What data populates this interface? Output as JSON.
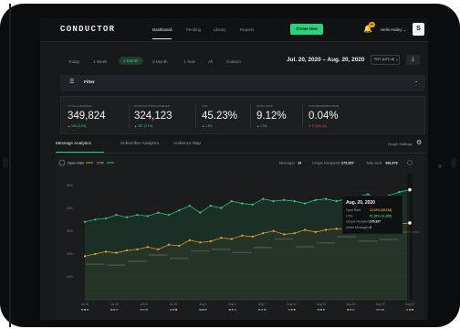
{
  "app": {
    "logo": "CONDUCTOR"
  },
  "nav": {
    "items": [
      "Dashboard",
      "Pending",
      "Library",
      "Reports"
    ],
    "create_label": "Create New",
    "notification_count": "9+",
    "user_label": "Hello Hailey",
    "avatar_letter": "S"
  },
  "date": {
    "ranges": [
      "Today",
      "1 Week",
      "1 Month",
      "3 Month",
      "1 Year",
      "All",
      "Custom"
    ],
    "selected": "1 Month",
    "display": "Jul. 20, 2020 – Aug. 20, 2020",
    "timezone": "PDT (UTC-8)"
  },
  "filter": {
    "label": "Filter"
  },
  "stats": [
    {
      "label": "TOTAL AUDIENCE",
      "value": "349,824",
      "sub": "▲ 153 (0.4%)",
      "trend": "up"
    },
    {
      "label": "NOTIFICATIONS ENABLED",
      "value": "324,123",
      "sub": "▲ 387 (0.1%)",
      "trend": "up"
    },
    {
      "label": "CTR",
      "value": "45.23%",
      "sub": "▲ 1.5%",
      "trend": "up"
    },
    {
      "label": "OPEN RATE",
      "value": "9.12%",
      "sub": "▲ 1.5%",
      "trend": "up"
    },
    {
      "label": "UNSUBSCRIBED RATE",
      "value": "0.04%",
      "sub": "▼ 0.05% (1k)",
      "trend": "down"
    }
  ],
  "tabs": [
    "Message Analytics",
    "Subscriber Analytics",
    "Audience Map"
  ],
  "graph_settings_label": "Graph Settings",
  "chart_header": {
    "legend": [
      {
        "label": "Open Rate",
        "color": "#f5a524"
      },
      {
        "label": "CTR",
        "color": "#2cd37f"
      }
    ],
    "messages_label": "Messages",
    "messages_value": "19",
    "recipients_label": "Unique Recipients",
    "recipients_value": "275,357",
    "sent_label": "Total Sent",
    "sent_value": "436,976"
  },
  "chart_data": {
    "type": "line",
    "x": [
      "Jul 20",
      "Jul 21",
      "Jul 22",
      "Jul 23",
      "Jul 24",
      "Jul 25",
      "Jul 26",
      "Jul 27",
      "Jul 28",
      "Jul 29",
      "Jul 30",
      "Jul 31",
      "Aug 1",
      "Aug 2",
      "Aug 3",
      "Aug 4",
      "Aug 5",
      "Aug 6",
      "Aug 7",
      "Aug 8",
      "Aug 9",
      "Aug 10",
      "Aug 11",
      "Aug 12",
      "Aug 13",
      "Aug 14",
      "Aug 15",
      "Aug 16",
      "Aug 17",
      "Aug 18",
      "Aug 19",
      "Aug 20"
    ],
    "x_tick_labels": [
      "Jul 20",
      "Jul 23",
      "Jul 26",
      "Jul 29",
      "Aug 1",
      "Aug 4",
      "Aug 7",
      "Aug 10",
      "Aug 13",
      "Aug 16",
      "Aug 19",
      "Aug 22"
    ],
    "y_ticks": [
      "50%",
      "40%",
      "30%",
      "20%",
      "10%"
    ],
    "ylim": [
      0,
      55
    ],
    "series": [
      {
        "name": "CTR",
        "color": "#2cd37f",
        "values": [
          34,
          35,
          35.5,
          37,
          36,
          37,
          36.5,
          38,
          37,
          39,
          41,
          38,
          41,
          40,
          43,
          42,
          41.5,
          44,
          43,
          43.5,
          43,
          42,
          43.5,
          44,
          43,
          44,
          45,
          46,
          44,
          45.5,
          47,
          48
        ]
      },
      {
        "name": "Open Rate",
        "color": "#f5a524",
        "values": [
          19,
          20,
          21,
          20.5,
          21.5,
          22,
          23,
          22,
          24,
          23.5,
          26,
          25,
          25.5,
          27,
          26.5,
          28,
          27.5,
          29,
          30,
          28.5,
          29,
          30.5,
          29.5,
          30.5,
          31,
          30.5,
          31.5,
          32,
          31,
          32,
          33,
          33.5
        ]
      }
    ],
    "tooltip": {
      "date": "Aug. 20, 2020",
      "rows": [
        {
          "label": "Open Rate",
          "value": "12.13% (25,134)",
          "color": "#f5a524"
        },
        {
          "label": "CTR",
          "value": "51.38% (11,298)",
          "color": "#2cd37f"
        },
        {
          "label": "Unique Recipients",
          "value": "275,357",
          "color": "#eef1f3"
        },
        {
          "label": "Active Messages",
          "value": "2",
          "color": "#eef1f3"
        }
      ]
    }
  }
}
